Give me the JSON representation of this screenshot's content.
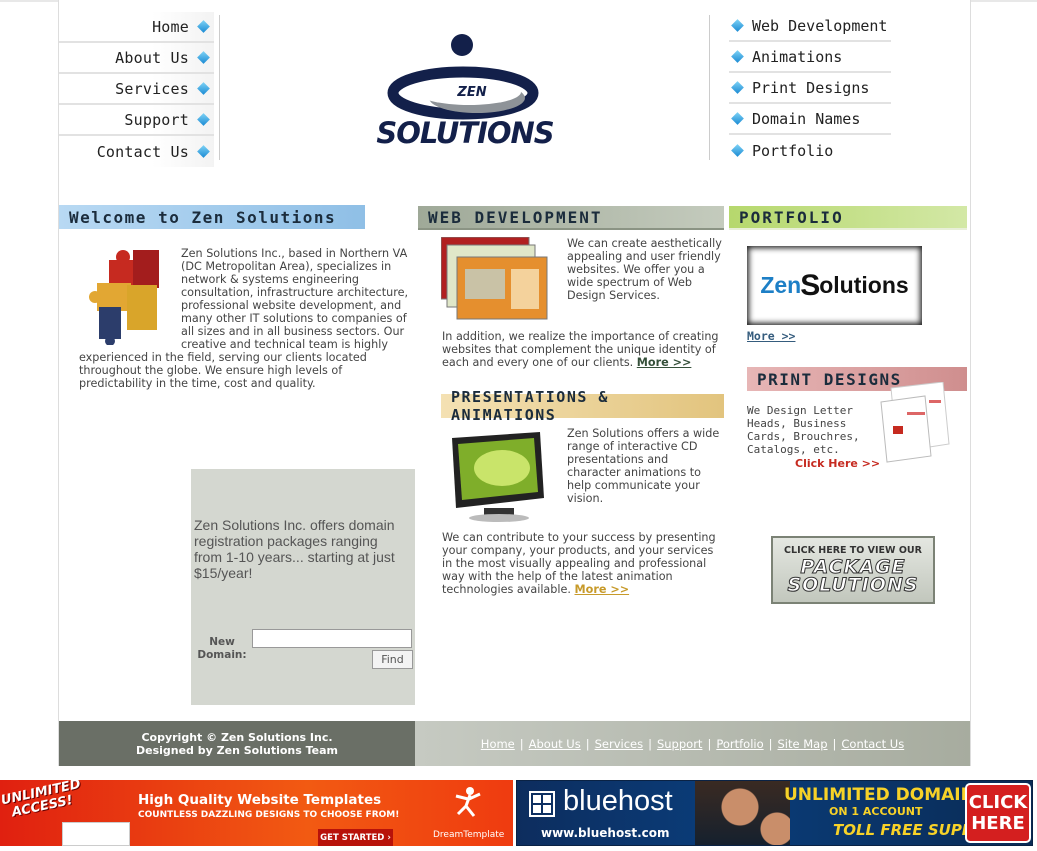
{
  "nav_left": [
    "Home",
    "About Us",
    "Services",
    "Support",
    "Contact Us"
  ],
  "nav_right": [
    "Web Development",
    "Animations",
    "Print Designs",
    "Domain Names",
    "Portfolio"
  ],
  "logo": {
    "small": "ZEN",
    "big": "SOLUTIONS"
  },
  "welcome": {
    "title": "Welcome to Zen Solutions",
    "text": "Zen Solutions Inc., based in Northern VA (DC Metropolitan Area), specializes in network & systems engineering consultation, infrastructure architecture, professional website development, and many other IT solutions to companies of all sizes and in all business sectors. Our creative and technical team is highly experienced in the field, serving our clients located throughout the globe. We ensure high levels of predictability in the time, cost and quality."
  },
  "domain_box": {
    "text": "Zen Solutions Inc. offers domain registration packages ranging from 1-10 years... starting at just $15/year!",
    "label_line1": "New",
    "label_line2": "Domain:",
    "input_value": "",
    "button": "Find"
  },
  "webdev": {
    "title": "WEB DEVELOPMENT",
    "text1": "We can create aesthetically appealing and user friendly websites. We offer you a wide spectrum of Web Design Services.",
    "text2": "In addition, we realize the importance of creating websites that complement the unique identity of each and every one of our clients.",
    "more": "More >>"
  },
  "presentations": {
    "title": "PRESENTATIONS & ANIMATIONS",
    "text1": "Zen Solutions offers a wide range of interactive CD presentations and character animations to help communicate your vision.",
    "text2": "We can contribute to your success by presenting your company, your products, and your services in the most visually appealing and professional way with the help of the latest animation technologies available.",
    "more": "More >>"
  },
  "portfolio": {
    "title": "PORTFOLIO",
    "logo_left": "Zen",
    "logo_right": "olutions",
    "more": "More >>"
  },
  "print": {
    "title": "PRINT DESIGNS",
    "text": "We Design Letter Heads, Business Cards, Brouchres, Catalogs, etc.",
    "click": "Click Here >>"
  },
  "package": {
    "line1": "CLICK HERE TO VIEW OUR",
    "line2": "PACKAGE",
    "line3": "SOLUTIONS"
  },
  "footer": {
    "copyright": "Copyright © Zen Solutions Inc.",
    "designed": "Designed by Zen Solutions Team",
    "links": [
      "Home",
      "About Us",
      "Services",
      "Support",
      "Portfolio",
      "Site Map",
      "Contact Us"
    ]
  },
  "ad1": {
    "badge1": "UNLIMITED",
    "badge2": "ACCESS!",
    "title": "High Quality Website Templates",
    "subtitle": "COUNTLESS DAZZLING DESIGNS TO CHOOSE FROM!",
    "button": "GET STARTED",
    "brand": "DreamTemplate"
  },
  "ad2": {
    "brand": "bluehost",
    "url": "www.bluehost.com",
    "headline1": "UNLIMITED DOMAINS",
    "headline2": "ON 1 ACCOUNT",
    "headline3": "TOLL FREE SUPPORT",
    "click1": "CLICK",
    "click2": "HERE"
  },
  "colors": {
    "accent_blue": "#1a8ad3",
    "navy": "#13204a",
    "footer_dark": "#6a6f66",
    "welcome_bar": "#9fc7ea",
    "webdev_bar": "#aab3a3",
    "portfolio_bar": "#c3dc8a",
    "print_bar": "#d49a9a",
    "presentations_bar": "#e7c97f"
  }
}
